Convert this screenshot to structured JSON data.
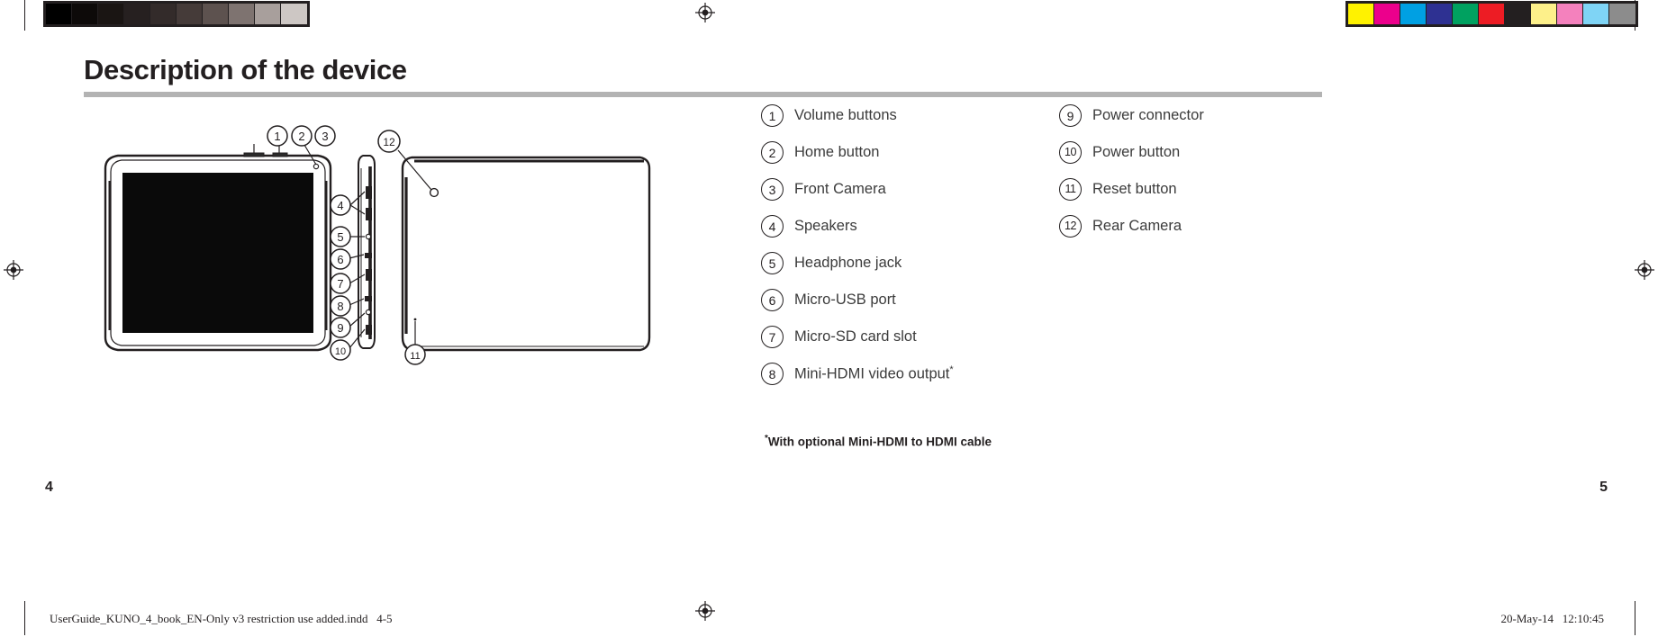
{
  "document": {
    "heading": "Description of the device",
    "heading_rule_color": "#b3b3b3",
    "page_number_left": "4",
    "page_number_right": "5"
  },
  "footnote": {
    "marker": "*",
    "text": "With optional Mini-HDMI to HDMI cable"
  },
  "legend": {
    "left_column": [
      {
        "number": "1",
        "label": "Volume buttons"
      },
      {
        "number": "2",
        "label": "Home button"
      },
      {
        "number": "3",
        "label": "Front Camera"
      },
      {
        "number": "4",
        "label": "Speakers"
      },
      {
        "number": "5",
        "label": "Headphone jack"
      },
      {
        "number": "6",
        "label": "Micro-USB port"
      },
      {
        "number": "7",
        "label": "Micro-SD card slot"
      },
      {
        "number": "8",
        "label": "Mini-HDMI video output",
        "footnote_marker": "*"
      }
    ],
    "right_column": [
      {
        "number": "9",
        "label": "Power connector"
      },
      {
        "number": "10",
        "label": "Power button"
      },
      {
        "number": "11",
        "label": "Reset button"
      },
      {
        "number": "12",
        "label": "Rear Camera"
      }
    ]
  },
  "illustration": {
    "caption": "Tablet device line drawing: front view, left-edge side view and rear view with numbered callouts",
    "callouts_front": [
      "1",
      "2",
      "3"
    ],
    "callouts_side": [
      "4",
      "5",
      "6",
      "7",
      "8",
      "9",
      "10"
    ],
    "callouts_rear": [
      "11",
      "12"
    ]
  },
  "calibration": {
    "grayscale_swatches": [
      "#000000",
      "#0d0a09",
      "#1a1513",
      "#262020",
      "#332b2a",
      "#453b39",
      "#5d524f",
      "#7e7370",
      "#a89f9c",
      "#cdc7c4"
    ],
    "color_swatches": [
      "#fff200",
      "#ec008c",
      "#00a0e3",
      "#2e3192",
      "#00a160",
      "#ed1c24",
      "#231f20",
      "#fdf08a",
      "#f481bd",
      "#7fd4f5",
      "#8c8c8c"
    ]
  },
  "footer": {
    "filename": "UserGuide_KUNO_4_book_EN-Only v3 restriction use added.indd   4-5",
    "timestamp": "20-May-14   12:10:45"
  }
}
